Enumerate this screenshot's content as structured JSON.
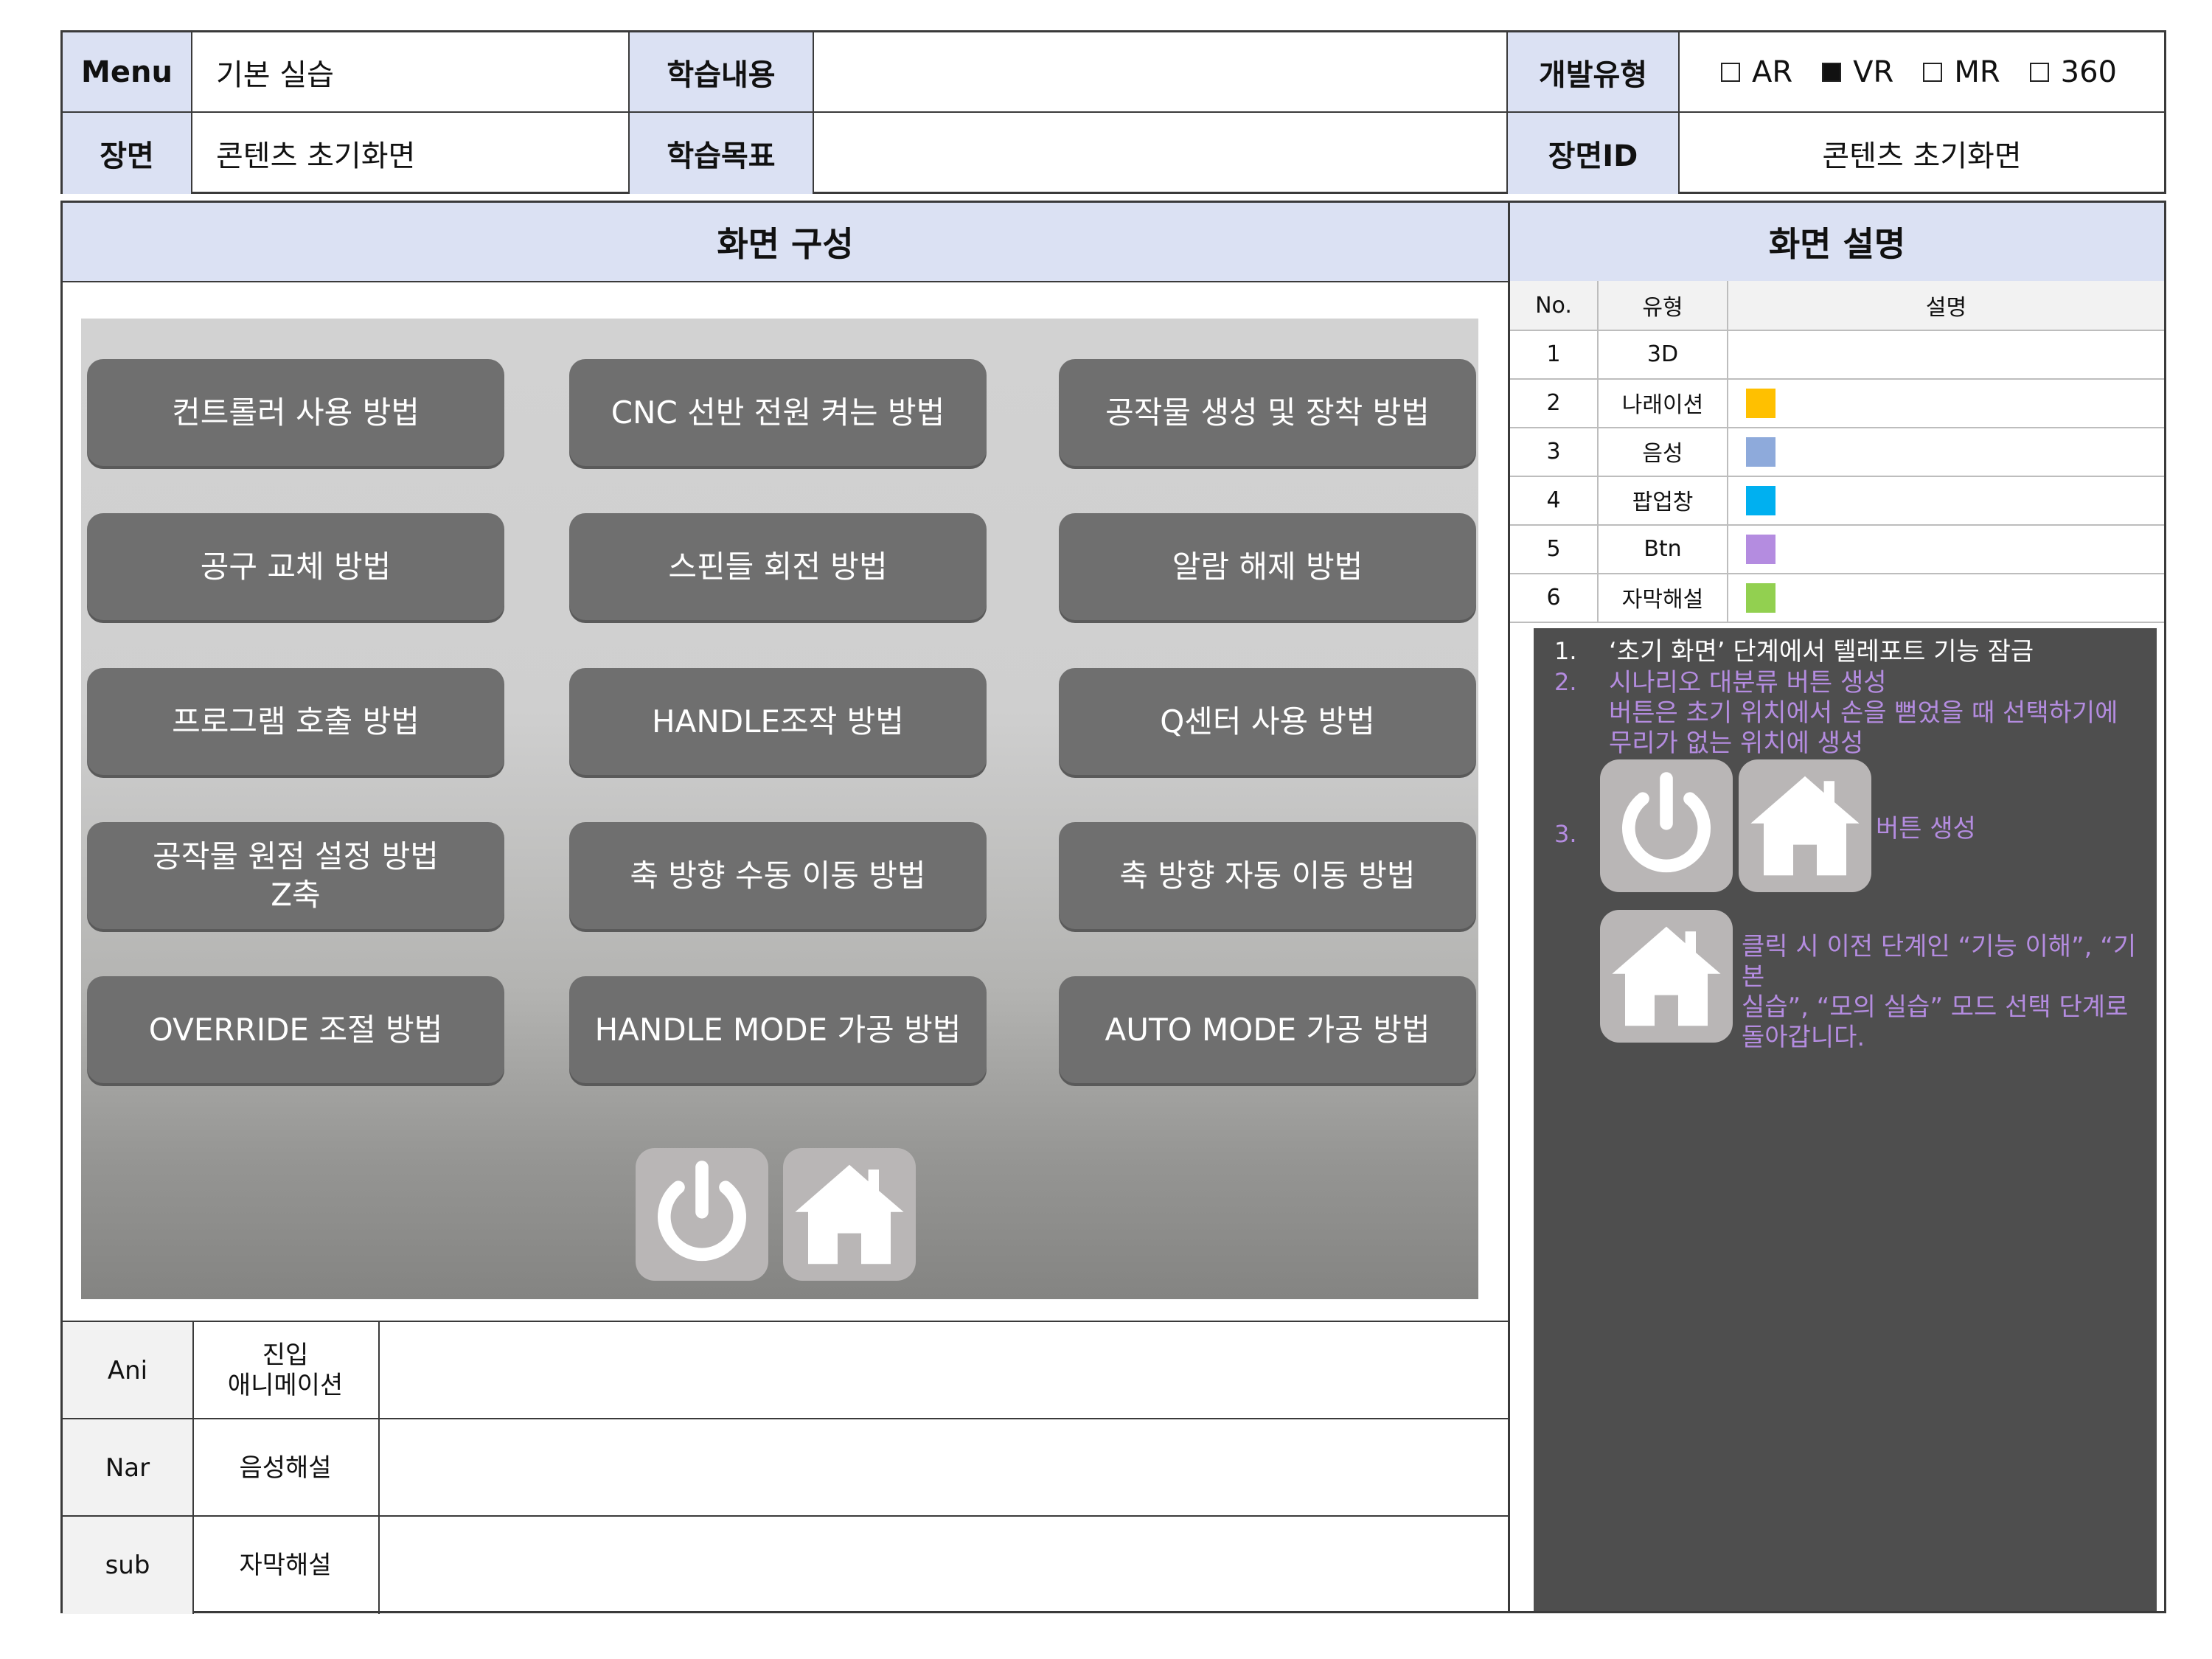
{
  "header": {
    "menu_label": "Menu",
    "menu_value": "기본 실습",
    "learn_content_label": "학습내용",
    "learn_content_value": "",
    "dev_type_label": "개발유형",
    "dev_types": [
      {
        "label": "AR",
        "checked": false
      },
      {
        "label": "VR",
        "checked": true
      },
      {
        "label": "MR",
        "checked": false
      },
      {
        "label": "360",
        "checked": false
      }
    ],
    "scene_label": "장면",
    "scene_value": "콘텐츠 초기화면",
    "learn_goal_label": "학습목표",
    "learn_goal_value": "",
    "scene_id_label": "장면ID",
    "scene_id_value": "콘텐츠 초기화면"
  },
  "composition": {
    "title": "화면 구성",
    "menu_buttons": [
      "컨트롤러 사용 방법",
      "CNC 선반 전원 켜는 방법",
      "공작물 생성 및 장착 방법",
      "공구 교체 방법",
      "스핀들 회전 방법",
      "알람 해제 방법",
      "프로그램 호출 방법",
      "HANDLE조작 방법",
      "Q센터 사용 방법",
      "공작물 원점 설정 방법\nZ축",
      "축 방향 수동 이동 방법",
      "축 방향 자동 이동 방법",
      "OVERRIDE 조절 방법",
      "HANDLE MODE 가공 방법",
      "AUTO MODE 가공 방법"
    ],
    "icon_buttons": [
      "power-icon",
      "home-icon"
    ]
  },
  "bottom_rows": [
    {
      "code": "Ani",
      "type": "진입\n애니메이션",
      "content": ""
    },
    {
      "code": "Nar",
      "type": "음성해설",
      "content": ""
    },
    {
      "code": "sub",
      "type": "자막해설",
      "content": ""
    }
  ],
  "description": {
    "title": "화면 설명",
    "columns": [
      "No.",
      "유형",
      "설명"
    ],
    "rows": [
      {
        "no": "1",
        "type": "3D",
        "color": ""
      },
      {
        "no": "2",
        "type": "나래이션",
        "color": "#ffc000"
      },
      {
        "no": "3",
        "type": "음성",
        "color": "#8eaadb"
      },
      {
        "no": "4",
        "type": "팝업창",
        "color": "#00b0f0"
      },
      {
        "no": "5",
        "type": "Btn",
        "color": "#b48ce0"
      },
      {
        "no": "6",
        "type": "자막해설",
        "color": "#92d050"
      }
    ],
    "notes": {
      "n1_num": "1.",
      "n1_text": "‘초기 화면’ 단계에서 텔레포트 기능 잠금",
      "n2_num": "2.",
      "n2_text": "시나리오 대분류 버튼 생성\n버튼은 초기 위치에서 손을 뻗었을 때 선택하기에\n무리가 없는 위치에 생성",
      "n3_num": "3.",
      "n3_text": "버튼 생성",
      "home_text": "클릭 시 이전 단계인 “기능 이해”, “기본\n실습”, “모의 실습” 모드 선택 단계로\n돌아갑니다."
    },
    "white_color": "#ffffff",
    "accent_color": "#b48ce0"
  }
}
